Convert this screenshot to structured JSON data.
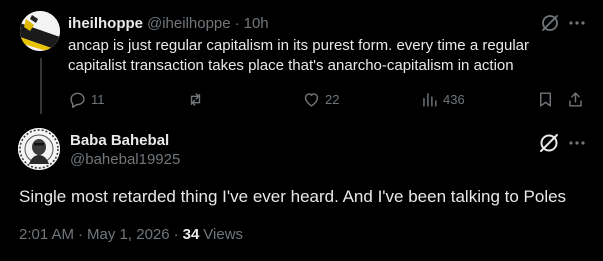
{
  "parent_tweet": {
    "display_name": "iheilhoppe",
    "handle": "@iheilhoppe",
    "separator": "·",
    "time": "10h",
    "text": "ancap is just regular capitalism in its purest form. every time a regular capitalist transaction takes place that's anarcho-capitalism in action",
    "replies": "11",
    "reposts": "",
    "likes": "22",
    "views": "436",
    "icons": [
      "grok-icon",
      "more-icon",
      "reply-icon",
      "repost-icon",
      "like-icon",
      "views-icon",
      "bookmark-icon",
      "share-icon"
    ]
  },
  "main_tweet": {
    "display_name": "Baba Bahebal",
    "handle": "@bahebal19925",
    "text": "Single most retarded thing I've ever heard. And I've been talking to Poles",
    "time": "2:01 AM",
    "date": "May 1, 2026",
    "separator": "·",
    "views_count": "34",
    "views_label": "Views",
    "icons": [
      "grok-icon",
      "more-icon"
    ]
  },
  "colors": {
    "background": "#000000",
    "primary_text": "#e7e9ea",
    "secondary_text": "#71767b",
    "thread_line": "#333639"
  }
}
